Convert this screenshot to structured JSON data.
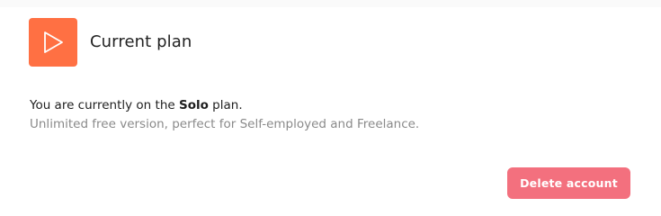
{
  "plan_card": {
    "icon": "play-icon",
    "title": "Current plan",
    "current_plan_prefix": "You are currently on the ",
    "current_plan_name": "Solo",
    "current_plan_suffix": " plan.",
    "description": "Unlimited free version, perfect for Self-employed and Freelance."
  },
  "actions": {
    "delete_account_label": "Delete account"
  },
  "colors": {
    "icon_background": "#ff7043",
    "danger_button": "#f3707e",
    "description_text": "#8a8a8a"
  }
}
